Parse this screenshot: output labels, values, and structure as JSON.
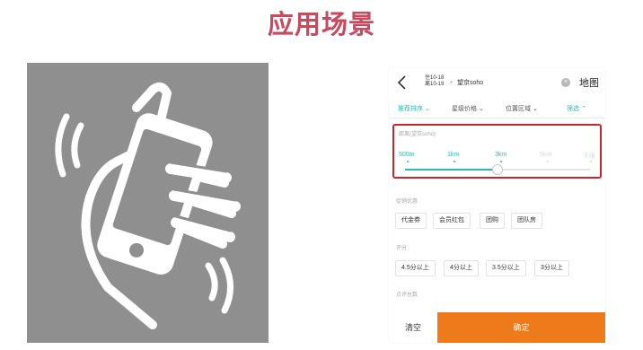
{
  "slide": {
    "title": "应用场景"
  },
  "illustration": {
    "icon": "shaking-phone-in-hand-icon",
    "background": "#8f8f8f"
  },
  "search_bar": {
    "check_in": "住10-18",
    "check_out": "离10-19",
    "keyword": "望京soho",
    "map_label": "地图"
  },
  "filter_tabs": [
    {
      "label": "推荐排序",
      "active": true
    },
    {
      "label": "星级价格",
      "active": false
    },
    {
      "label": "位置区域",
      "active": false
    },
    {
      "label": "筛选",
      "active": true
    }
  ],
  "distance": {
    "label": "距离(望京soho)",
    "options": [
      "500m",
      "1km",
      "3km",
      "5km",
      "不限"
    ],
    "selected": "3km",
    "highlight_color": "#c9252c"
  },
  "promotions": {
    "label": "促销优惠",
    "chips": [
      "代金券",
      "会员红包",
      "团购",
      "团队房"
    ]
  },
  "rating": {
    "label": "评分",
    "chips": [
      "4.5分以上",
      "4分以上",
      "3.5分以上",
      "3分以上"
    ]
  },
  "review_count": {
    "label": "点评总数"
  },
  "footer": {
    "clear_label": "清空",
    "confirm_label": "确定",
    "confirm_color": "#ef7a1a"
  },
  "colors": {
    "title": "#c84a5f",
    "accent": "#2fb8b3"
  }
}
